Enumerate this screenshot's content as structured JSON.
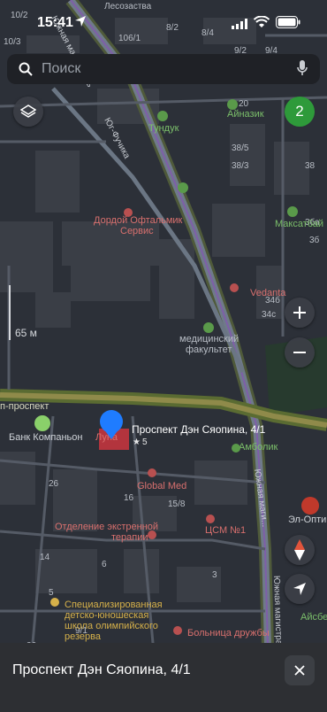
{
  "status_bar": {
    "time": "15:41"
  },
  "search": {
    "placeholder": "Поиск"
  },
  "badge_count": "2",
  "scale_label": "65 м",
  "selected_place": {
    "name": "Проспект Дэн Сяопина, 4/1",
    "rating": "5"
  },
  "bottom_sheet": {
    "title": "Проспект Дэн Сяопина, 4/1"
  },
  "map_labels": {
    "tundyk": "Тундук",
    "ainazik": "Айназик",
    "dordoi": "Дордой Офтальмик",
    "dordoi2": "Сервис",
    "maxatbay": "Максатбай",
    "vedanta": "Vedanta",
    "medfac1": "медицинский",
    "medfac2": "факультет",
    "avenue": "п-проспект",
    "bank": "Банк Компаньон",
    "luna": "Луна",
    "ambolik": "Амболик",
    "globalmed": "Global Med",
    "emergency1": "Отделение экстренной",
    "emergency2": "терапии",
    "csm": "ЦСМ №1",
    "eloptik": "Эл-Оптик",
    "olimp1": "Специализированная",
    "olimp2": "детско-юношеская",
    "olimp3": "школа олимпийского",
    "olimp4": "резерва",
    "friendship": "Больница дружбы",
    "aisbek": "Айсбе",
    "lesozastava": "Лесозаства",
    "street_yug": "Южная магистраль",
    "street_yug2": "Южная маги...",
    "street_yugfuch": "Юг-Фучика",
    "house_5": "5",
    "h1": "106/1",
    "h2": "8/2",
    "h3": "8/4",
    "h4": "9/2",
    "h5": "9/4",
    "h6": "10/3",
    "h7": "10/2",
    "h8": "20",
    "h9": "38/5",
    "h10": "38/3",
    "h11": "38",
    "h12": "3ба",
    "h13": "3б",
    "h14": "34б",
    "h15": "34с",
    "h16": "26",
    "h17": "16",
    "h18": "15/8",
    "h19": "14",
    "h20": "6",
    "h21": "3",
    "h22": "5",
    "h23": "9/1",
    "h24": "36"
  }
}
